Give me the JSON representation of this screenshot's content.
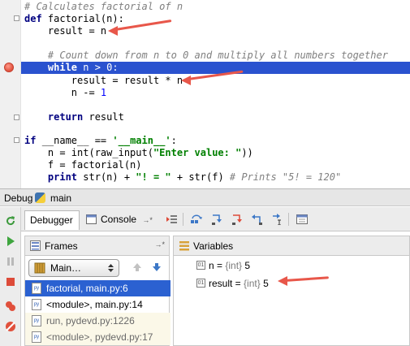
{
  "editor": {
    "lines": [
      {
        "parts": [
          {
            "c": "cmt",
            "t": "# Calculates factorial of n"
          }
        ]
      },
      {
        "parts": [
          {
            "c": "kw",
            "t": "def "
          },
          {
            "c": "",
            "t": "factorial(n):"
          }
        ]
      },
      {
        "parts": [
          {
            "c": "",
            "t": "    result = n"
          }
        ]
      },
      {
        "parts": [
          {
            "c": "",
            "t": ""
          }
        ]
      },
      {
        "parts": [
          {
            "c": "cmt",
            "t": "    # Count down from n to 0 and multiply all numbers together"
          }
        ]
      },
      {
        "parts": [
          {
            "c": "",
            "t": "    "
          },
          {
            "c": "kw",
            "t": "while "
          },
          {
            "c": "",
            "t": "n > "
          },
          {
            "c": "num",
            "t": "0"
          },
          {
            "c": "",
            "t": ":"
          }
        ]
      },
      {
        "parts": [
          {
            "c": "",
            "t": "        result = result * n"
          }
        ]
      },
      {
        "parts": [
          {
            "c": "",
            "t": "        n -= "
          },
          {
            "c": "num",
            "t": "1"
          }
        ]
      },
      {
        "parts": [
          {
            "c": "",
            "t": ""
          }
        ]
      },
      {
        "parts": [
          {
            "c": "",
            "t": "    "
          },
          {
            "c": "kw",
            "t": "return "
          },
          {
            "c": "",
            "t": "result"
          }
        ]
      },
      {
        "parts": [
          {
            "c": "",
            "t": ""
          }
        ]
      },
      {
        "parts": [
          {
            "c": "kw",
            "t": "if "
          },
          {
            "c": "",
            "t": "__name__ == "
          },
          {
            "c": "str",
            "t": "'__main__'"
          },
          {
            "c": "",
            "t": ":"
          }
        ]
      },
      {
        "parts": [
          {
            "c": "",
            "t": "    n = int(raw_input("
          },
          {
            "c": "str",
            "t": "\"Enter value: \""
          },
          {
            "c": "",
            "t": "))"
          }
        ]
      },
      {
        "parts": [
          {
            "c": "",
            "t": "    f = factorial(n)"
          }
        ]
      },
      {
        "parts": [
          {
            "c": "",
            "t": "    "
          },
          {
            "c": "kw",
            "t": "print "
          },
          {
            "c": "",
            "t": "str(n) + "
          },
          {
            "c": "str",
            "t": "\"! = \""
          },
          {
            "c": "",
            "t": " + str(f) "
          },
          {
            "c": "cmt",
            "t": "# Prints \"5! = 120\""
          }
        ]
      }
    ],
    "execution_line_index": 5,
    "breakpoint_line_index": 5
  },
  "debug": {
    "title": "Debug",
    "config_name": "main",
    "tabs": {
      "debugger": "Debugger",
      "console": "Console",
      "console_suffix": "→*"
    },
    "frames": {
      "label": "Frames",
      "pin": "→*",
      "thread": "Main…",
      "items": [
        {
          "label": "factorial, main.py:6",
          "selected": true,
          "library": false
        },
        {
          "label": "<module>, main.py:14",
          "selected": false,
          "library": false
        },
        {
          "label": "run, pydevd.py:1226",
          "selected": false,
          "library": true
        },
        {
          "label": "<module>, pydevd.py:17",
          "selected": false,
          "library": true
        }
      ]
    },
    "variables": {
      "label": "Variables",
      "items": [
        {
          "name": "n",
          "type": "{int}",
          "value": "5"
        },
        {
          "name": "result",
          "type": "{int}",
          "value": "5"
        }
      ]
    }
  },
  "colors": {
    "execution_line": "#2a52cf",
    "selected_frame": "#2b61d1",
    "annotation_arrow": "#e8574a",
    "breakpoint": "#e0503c"
  }
}
